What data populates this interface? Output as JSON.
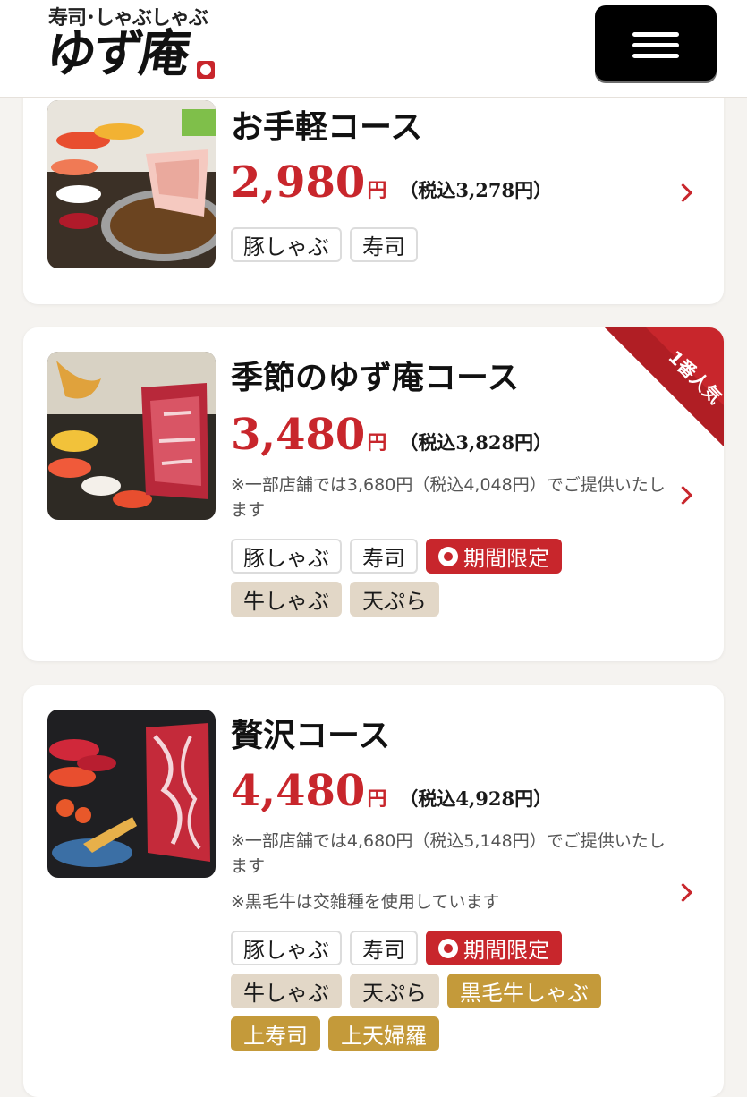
{
  "header": {
    "logo_sub": "寿司･しゃぶしゃぶ",
    "logo_main": "ゆず庵",
    "menu_icon": "hamburger-menu-icon"
  },
  "colors": {
    "accent": "#c8262c",
    "beige_tag": "#e2d7c7",
    "gold_tag": "#c49a3a",
    "page_bg": "#f5f3f0"
  },
  "courses": [
    {
      "title": "お手軽コース",
      "price": "2,980",
      "yen": "円",
      "tax": "（税込3,278円）",
      "tags": [
        {
          "label": "豚しゃぶ",
          "style": "plain"
        },
        {
          "label": "寿司",
          "style": "plain"
        }
      ]
    },
    {
      "title": "季節のゆず庵コース",
      "price": "3,480",
      "yen": "円",
      "tax": "（税込3,828円）",
      "ribbon": "1番人気",
      "notes": [
        "※一部店舗では3,680円（税込4,048円）でご提供いたします"
      ],
      "tags": [
        {
          "label": "豚しゃぶ",
          "style": "plain"
        },
        {
          "label": "寿司",
          "style": "plain"
        },
        {
          "label": "期間限定",
          "style": "limited"
        },
        {
          "label": "牛しゃぶ",
          "style": "beige"
        },
        {
          "label": "天ぷら",
          "style": "beige"
        }
      ]
    },
    {
      "title": "贅沢コース",
      "price": "4,480",
      "yen": "円",
      "tax": "（税込4,928円）",
      "notes": [
        "※一部店舗では4,680円（税込5,148円）でご提供いたします",
        "※黒毛牛は交雑種を使用しています"
      ],
      "tags": [
        {
          "label": "豚しゃぶ",
          "style": "plain"
        },
        {
          "label": "寿司",
          "style": "plain"
        },
        {
          "label": "期間限定",
          "style": "limited"
        },
        {
          "label": "牛しゃぶ",
          "style": "beige"
        },
        {
          "label": "天ぷら",
          "style": "beige"
        },
        {
          "label": "黒毛牛しゃぶ",
          "style": "gold"
        },
        {
          "label": "上寿司",
          "style": "gold"
        },
        {
          "label": "上天婦羅",
          "style": "gold"
        }
      ]
    }
  ]
}
